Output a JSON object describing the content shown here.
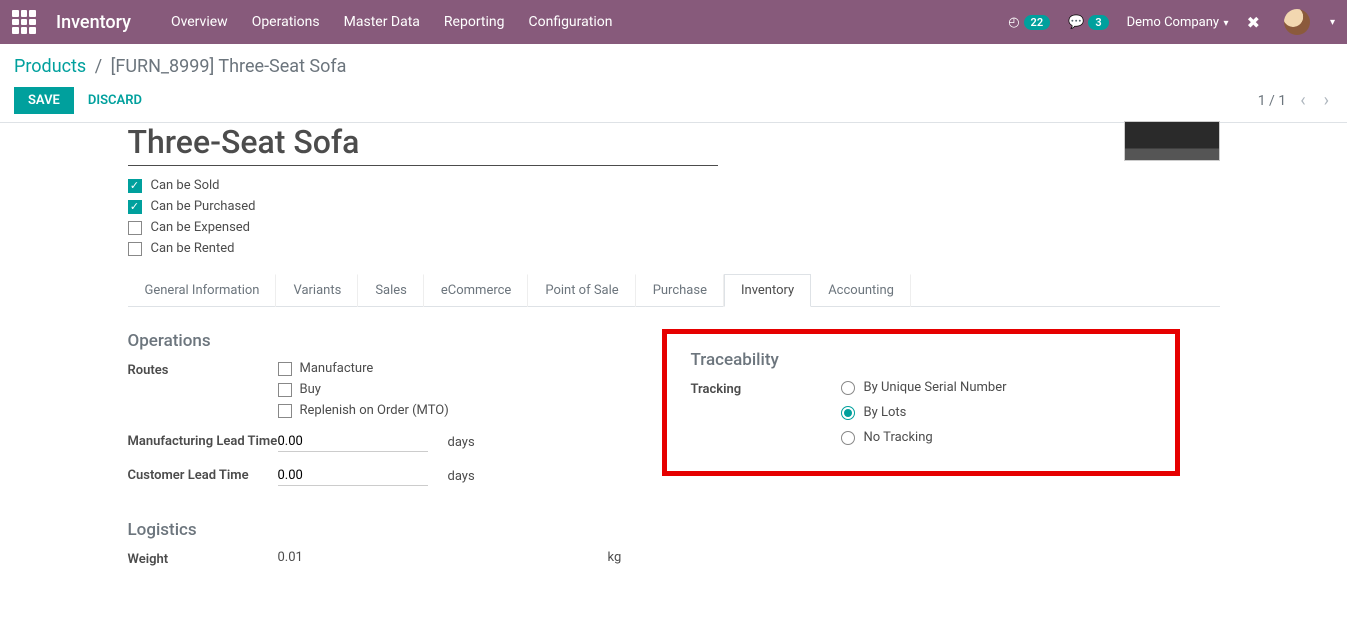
{
  "topbar": {
    "brand": "Inventory",
    "nav": [
      "Overview",
      "Operations",
      "Master Data",
      "Reporting",
      "Configuration"
    ],
    "clock_badge": "22",
    "msg_badge": "3",
    "company": "Demo Company"
  },
  "breadcrumb": {
    "root": "Products",
    "current": "[FURN_8999] Three-Seat Sofa"
  },
  "actions": {
    "save": "SAVE",
    "discard": "DISCARD",
    "pager": "1 / 1"
  },
  "product": {
    "name": "Three-Seat Sofa",
    "flags": [
      {
        "label": "Can be Sold",
        "checked": true
      },
      {
        "label": "Can be Purchased",
        "checked": true
      },
      {
        "label": "Can be Expensed",
        "checked": false
      },
      {
        "label": "Can be Rented",
        "checked": false
      }
    ]
  },
  "tabs": [
    "General Information",
    "Variants",
    "Sales",
    "eCommerce",
    "Point of Sale",
    "Purchase",
    "Inventory",
    "Accounting"
  ],
  "active_tab": "Inventory",
  "operations": {
    "title": "Operations",
    "routes_label": "Routes",
    "routes": [
      {
        "label": "Manufacture",
        "checked": false
      },
      {
        "label": "Buy",
        "checked": false
      },
      {
        "label": "Replenish on Order (MTO)",
        "checked": false
      }
    ],
    "mfg_lead_label": "Manufacturing Lead Time",
    "mfg_lead_value": "0.00",
    "mfg_lead_unit": "days",
    "cust_lead_label": "Customer Lead Time",
    "cust_lead_value": "0.00",
    "cust_lead_unit": "days"
  },
  "traceability": {
    "title": "Traceability",
    "tracking_label": "Tracking",
    "options": [
      "By Unique Serial Number",
      "By Lots",
      "No Tracking"
    ],
    "selected": "By Lots"
  },
  "logistics": {
    "title": "Logistics",
    "weight_label": "Weight",
    "weight_value": "0.01",
    "weight_unit": "kg"
  }
}
